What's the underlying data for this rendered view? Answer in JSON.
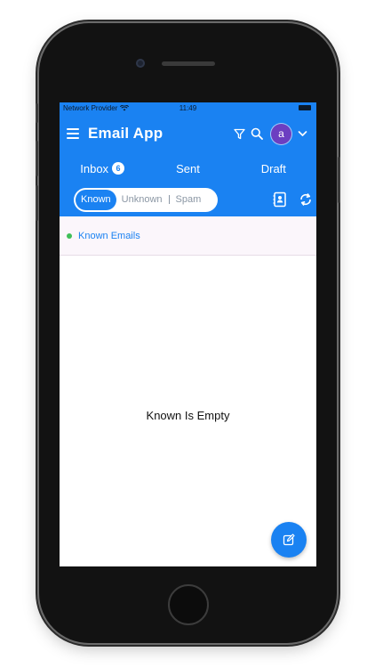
{
  "status": {
    "provider": "Network Provider",
    "time": "11:49"
  },
  "header": {
    "title": "Email App",
    "avatar_letter": "a"
  },
  "tabs": [
    {
      "label": "Inbox",
      "badge": "6"
    },
    {
      "label": "Sent"
    },
    {
      "label": "Draft"
    }
  ],
  "filter": {
    "segments": [
      {
        "label": "Known",
        "selected": true
      },
      {
        "label": "Unknown"
      },
      {
        "label": "Spam"
      }
    ]
  },
  "list": {
    "header_label": "Known Emails",
    "empty_text": "Known Is Empty"
  },
  "colors": {
    "primary": "#1a82f2",
    "avatar": "#6c3fc1",
    "dot": "#3fbf58"
  },
  "icons": [
    "menu-icon",
    "filter-icon",
    "search-icon",
    "chevron-down-icon",
    "contacts-icon",
    "refresh-icon",
    "compose-icon"
  ]
}
